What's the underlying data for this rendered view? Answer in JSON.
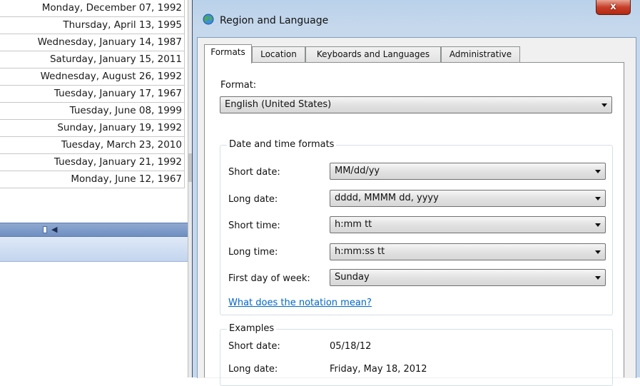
{
  "sheet": {
    "dates": [
      "Monday, December 07, 1992",
      "Thursday, April 13, 1995",
      "Wednesday, January 14, 1987",
      "Saturday, January 15, 2011",
      "Wednesday, August 26, 1992",
      "Tuesday, January 17, 1967",
      "Tuesday, June 08, 1999",
      "Sunday, January 19, 1992",
      "Tuesday, March 23, 2010",
      "Tuesday, January 21, 1992",
      "Monday, June 12, 1967"
    ]
  },
  "dialog": {
    "title": "Region and Language",
    "close_label": "x",
    "tabs": [
      {
        "label": "Formats",
        "active": true
      },
      {
        "label": "Location",
        "active": false
      },
      {
        "label": "Keyboards and Languages",
        "active": false
      },
      {
        "label": "Administrative",
        "active": false
      }
    ],
    "format_label": "Format:",
    "format_value": "English (United States)",
    "date_time_group": {
      "title": "Date and time formats",
      "rows": [
        {
          "label": "Short date:",
          "value": "MM/dd/yy"
        },
        {
          "label": "Long date:",
          "value": "dddd, MMMM dd, yyyy"
        },
        {
          "label": "Short time:",
          "value": "h:mm tt"
        },
        {
          "label": "Long time:",
          "value": "h:mm:ss tt"
        },
        {
          "label": "First day of week:",
          "value": "Sunday"
        }
      ],
      "link": "What does the notation mean?"
    },
    "examples_group": {
      "title": "Examples",
      "rows": [
        {
          "label": "Short date:",
          "value": "05/18/12"
        },
        {
          "label": "Long date:",
          "value": "Friday, May 18, 2012"
        }
      ]
    }
  },
  "colors": {
    "title_bar": "#b9d1ea",
    "close_button": "#c7402b",
    "link": "#0066cc",
    "scrollbar": "#6f8fc1"
  }
}
